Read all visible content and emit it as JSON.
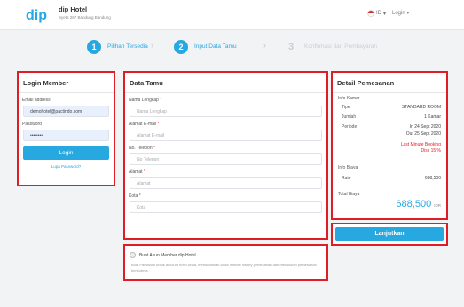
{
  "header": {
    "logo_text": "dip",
    "hotel_name": "dip Hotel",
    "hotel_address": "Syeta 267 Bandung Bandung",
    "language": "ID",
    "login_label": "Login"
  },
  "steps": [
    {
      "number": "1",
      "label": "Pilihan Tersedia"
    },
    {
      "number": "2",
      "label": "Input Data Tamu"
    },
    {
      "number": "3",
      "label": "Konfirmasi dan Pembayaran"
    }
  ],
  "login": {
    "title": "Login Member",
    "email_label": "Email address",
    "email_value": "demohotel@pactindo.com",
    "password_label": "Password",
    "password_value": "••••••••",
    "login_button": "Login",
    "forgot_link": "Lupa Password?"
  },
  "guest": {
    "title": "Data Tamu",
    "fields": [
      {
        "label": "Nama Lengkap",
        "placeholder": "Nama Lengkap"
      },
      {
        "label": "Alamat E-mail",
        "placeholder": "Alamat E-mail"
      },
      {
        "label": "No. Telepon",
        "placeholder": "No Telepon"
      },
      {
        "label": "Alamat",
        "placeholder": "Alamat"
      },
      {
        "label": "Kota",
        "placeholder": "Kota"
      }
    ],
    "required_mark": "*"
  },
  "member": {
    "checkbox_label": "Buat Akun Member dip Hotel",
    "description": "Buat Password untuk account hotel Anda, memudahkan Anda melihat history pemesanan dan melakukan pemesanan berikutnya."
  },
  "booking": {
    "title": "Detail Pemesanan",
    "room_section": "Info Kamar",
    "type_label": "Tipe",
    "type_value": "STANDARD ROOM",
    "count_label": "Jumlah",
    "count_value": "1 Kamar",
    "period_label": "Periode",
    "checkin": "In 24 Sept 2020",
    "checkout": "Out 25 Sept 2020",
    "promo_line1": "Last Minute Booking",
    "promo_line2": "Disc 15 %",
    "cost_section": "Info Biaya",
    "rate_label": "Rate",
    "rate_value": "688,500",
    "total_label": "Total Biaya",
    "total_value": "688,500",
    "currency": "IDR",
    "continue_button": "Lanjutkan"
  },
  "colors": {
    "accent": "#27a8e0",
    "highlight": "#e01c24",
    "inactive_step": "#c9ced4",
    "promo": "#e01c24"
  }
}
